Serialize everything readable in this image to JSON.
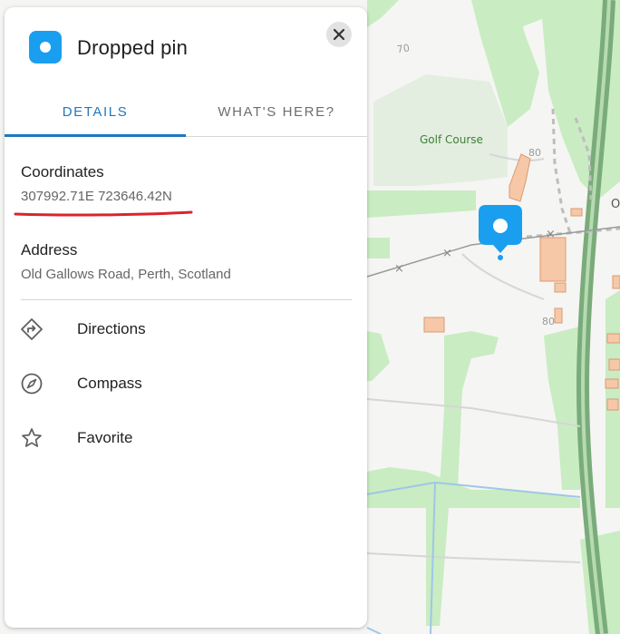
{
  "panel": {
    "title": "Dropped pin",
    "close_icon": "close-icon",
    "pin_icon": "location-dot-icon",
    "tabs": [
      {
        "label": "DETAILS",
        "active": true
      },
      {
        "label": "WHAT'S HERE?",
        "active": false
      }
    ],
    "coordinates": {
      "label": "Coordinates",
      "value": "307992.71E 723646.42N"
    },
    "address": {
      "label": "Address",
      "value": "Old Gallows Road, Perth, Scotland"
    },
    "actions": [
      {
        "label": "Directions",
        "icon": "directions-icon"
      },
      {
        "label": "Compass",
        "icon": "compass-icon"
      },
      {
        "label": "Favorite",
        "icon": "star-icon"
      }
    ]
  },
  "map": {
    "labels": {
      "golf_course": "Golf Course",
      "contour_70": "70",
      "contour_80_a": "80",
      "contour_80_b": "80",
      "edge_letter": "O"
    },
    "colors": {
      "background": "#f5f5f3",
      "green_area": "#c9ecc2",
      "golf_area": "#e3eee0",
      "building": "#f6c8a8",
      "main_road": "#7aab7a",
      "water": "#9fc6e8",
      "pin": "#1a9ef0",
      "accent_tab": "#1f78c1",
      "annotation_underline": "#d8262b"
    }
  }
}
